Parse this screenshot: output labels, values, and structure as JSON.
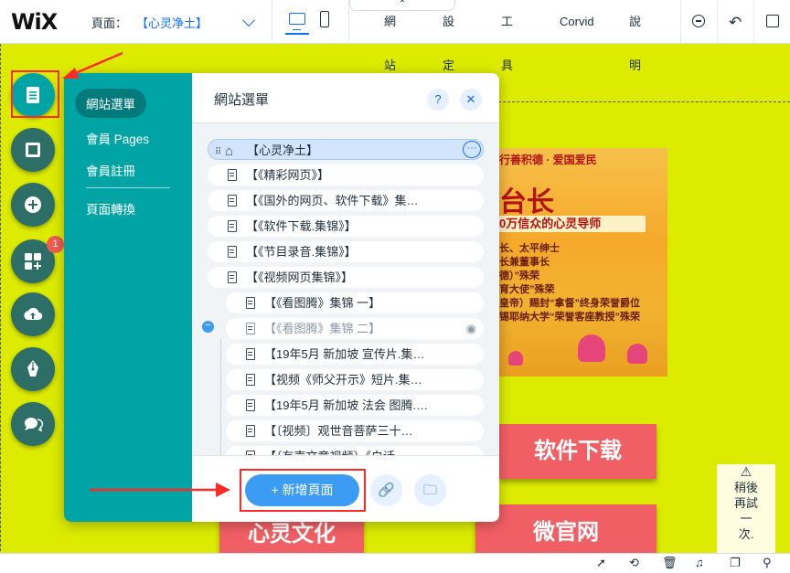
{
  "topbar": {
    "logo": "WiX",
    "page_label": "頁面：",
    "page_value": "【心灵净土】",
    "menu": [
      "網站",
      "設定",
      "工具",
      "Corvid",
      "說明"
    ],
    "collapse_glyph": "⌃"
  },
  "rail": {
    "badge_count": "1",
    "icons": [
      "pages-icon",
      "background-icon",
      "add-icon",
      "apps-icon",
      "upload-icon",
      "blog-pen-icon",
      "chat-icon"
    ]
  },
  "panel_nav": {
    "items": [
      "網站選單",
      "會員 Pages",
      "會員註冊",
      "頁面轉換"
    ]
  },
  "panel": {
    "title": "網站選單",
    "help": "?",
    "close": "✕",
    "pages": [
      {
        "label": "【心灵净土】",
        "type": "home"
      },
      {
        "label": "【《精彩网页》】",
        "type": "page"
      },
      {
        "label": "【《国外的网页、软件下载》集…",
        "type": "page"
      },
      {
        "label": "【《软件下载.集锦》】",
        "type": "page"
      },
      {
        "label": "【《节目录音.集锦》】",
        "type": "page"
      },
      {
        "label": "【《视频网页集锦》】",
        "type": "parent"
      },
      {
        "label": "【《看图腾》集锦 一】",
        "type": "child"
      },
      {
        "label": "【《看图腾》集锦 二】",
        "type": "hidden"
      },
      {
        "label": "【19年5月 新加坡 宣传片.集…",
        "type": "child"
      },
      {
        "label": "【视频《师父开示》短片.集…",
        "type": "child"
      },
      {
        "label": "【19年5月 新加坡 法会 图腾.…",
        "type": "child"
      },
      {
        "label": "【〔视频〕观世音菩萨三十…",
        "type": "child"
      },
      {
        "label": "【〔有声文章视频〕《白话…",
        "type": "child"
      }
    ],
    "add_page": "+ 新增頁面"
  },
  "canvas": {
    "banner": {
      "line1": "行善积德 · 爱国爱民",
      "line2": "台长",
      "line3": "0万信众的心灵导师",
      "line4": "长、太平绅士",
      "line5": "长兼董事长",
      "line6": "德）”殊荣",
      "line7": "育大使”殊荣",
      "line8": "皇帝）赐封“拿督”终身荣誉爵位",
      "line9": "锡耶纳大学“荣誉客座教授”殊荣"
    },
    "btn_software": "软件下载",
    "btn_culture": "心灵文化",
    "btn_weibo": "微官网"
  },
  "retry": {
    "icon": "⚠",
    "text": [
      "稍後",
      "再試",
      "一",
      "次."
    ]
  },
  "colors": {
    "canvas_bg": "#dceb00",
    "panel_teal": "#00a4a4",
    "accent_blue": "#116dff",
    "button_red": "#f05f64",
    "annotation_red": "#ff2a2a"
  }
}
